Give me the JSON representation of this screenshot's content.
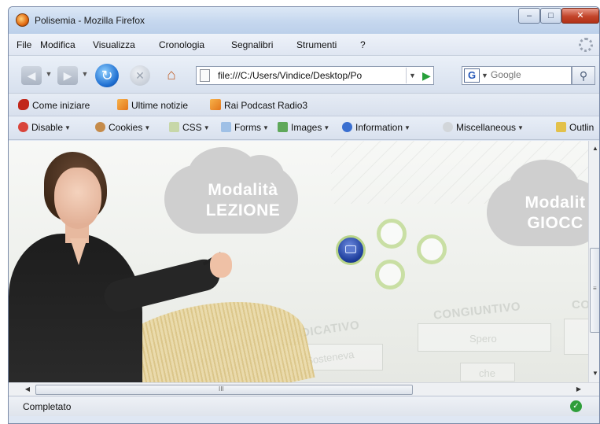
{
  "window": {
    "title": "Polisemia - Mozilla Firefox"
  },
  "menu": {
    "items": [
      "File",
      "Modifica",
      "Visualizza",
      "Cronologia",
      "Segnalibri",
      "Strumenti",
      "?"
    ]
  },
  "navigation": {
    "url": "file:///C:/Users/Vindice/Desktop/Po",
    "search_placeholder": "Google"
  },
  "bookmarks": {
    "items": [
      "Come iniziare",
      "Ultime notizie",
      "Rai Podcast Radio3"
    ]
  },
  "devtools": {
    "items": [
      "Disable",
      "Cookies",
      "CSS",
      "Forms",
      "Images",
      "Information",
      "Miscellaneous",
      "Outlin"
    ]
  },
  "content": {
    "cloud_lezione": {
      "line1": "Modalità",
      "line2": "LEZIONE"
    },
    "cloud_gioco": {
      "line1": "Modalit",
      "line2": "GIOCC"
    },
    "labels": {
      "indicativo": "INDICATIVO",
      "congiuntivo": "CONGIUNTIVO",
      "co": "CO"
    },
    "words": {
      "sosteneva": "Sosteneva",
      "spero": "Spero",
      "che": "che"
    }
  },
  "status": {
    "text": "Completato"
  },
  "colors": {
    "accent_ring": "#c9dfa4",
    "cloud": "#cfcfcf",
    "center_button": "#1f3f9e"
  }
}
